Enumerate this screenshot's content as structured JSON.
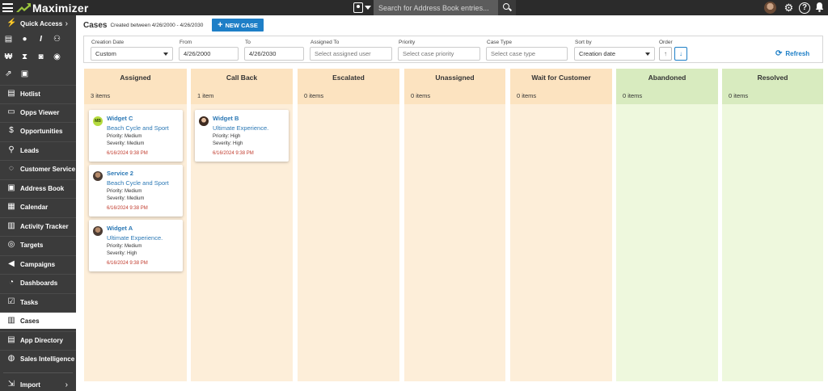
{
  "app": {
    "name": "Maximizer",
    "search_placeholder": "Search for Address Book entries..."
  },
  "sidebar": {
    "quick_access": "Quick Access",
    "items": [
      {
        "label": "Hotlist",
        "icon": "list-icon"
      },
      {
        "label": "Opps Viewer",
        "icon": "window-icon"
      },
      {
        "label": "Opportunities",
        "icon": "dollar-icon"
      },
      {
        "label": "Leads",
        "icon": "person-search-icon"
      },
      {
        "label": "Customer Service",
        "icon": "chat-icon"
      },
      {
        "label": "Address Book",
        "icon": "contact-card-icon"
      },
      {
        "label": "Calendar",
        "icon": "calendar-icon"
      },
      {
        "label": "Activity Tracker",
        "icon": "clipboard-icon"
      },
      {
        "label": "Targets",
        "icon": "target-icon"
      },
      {
        "label": "Campaigns",
        "icon": "megaphone-icon"
      },
      {
        "label": "Dashboards",
        "icon": "gauge-icon"
      },
      {
        "label": "Tasks",
        "icon": "tasks-icon"
      },
      {
        "label": "Cases",
        "icon": "cases-icon",
        "active": true
      },
      {
        "label": "App Directory",
        "icon": "app-directory-icon"
      },
      {
        "label": "Sales Intelligence",
        "icon": "globe-icon"
      }
    ],
    "import": "Import"
  },
  "page": {
    "title": "Cases",
    "subtitle": "Created between 4/26/2000 - 4/26/2030",
    "new_case": "NEW CASE"
  },
  "filters": {
    "creation_date": {
      "label": "Creation Date",
      "value": "Custom"
    },
    "from": {
      "label": "From",
      "value": "4/26/2000"
    },
    "to": {
      "label": "To",
      "value": "4/26/2030"
    },
    "assigned_to": {
      "label": "Assigned To",
      "placeholder": "Select assigned user"
    },
    "priority": {
      "label": "Priority",
      "placeholder": "Select case priority"
    },
    "case_type": {
      "label": "Case Type",
      "placeholder": "Select case type"
    },
    "sort_by": {
      "label": "Sort by",
      "value": "Creation date"
    },
    "order": {
      "label": "Order"
    },
    "refresh": "Refresh"
  },
  "columns": [
    {
      "title": "Assigned",
      "count": "3 items",
      "head_color": "#fce3c0",
      "body_color": "#fdeed9",
      "cards": [
        {
          "name": "Widget C",
          "company": "Beach Cycle and Sport",
          "priority": "Priority: Medium",
          "severity": "Severity: Medium",
          "date": "6/16/2024 9:38 PM",
          "avatar_initials": "MB"
        },
        {
          "name": "Service 2",
          "company": "Beach Cycle and Sport",
          "priority": "Priority: Medium",
          "severity": "Severity: Medium",
          "date": "6/16/2024 9:38 PM",
          "avatar_initials": ""
        },
        {
          "name": "Widget A",
          "company": "Ultimate Experience.",
          "priority": "Priority: Medium",
          "severity": "Severity: High",
          "date": "6/16/2024 9:38 PM",
          "avatar_initials": ""
        }
      ]
    },
    {
      "title": "Call Back",
      "count": "1 item",
      "head_color": "#fce3c0",
      "body_color": "#fdeed9",
      "cards": [
        {
          "name": "Widget B",
          "company": "Ultimate Experience.",
          "priority": "Priority: High",
          "severity": "Severity: High",
          "date": "6/16/2024 9:38 PM",
          "avatar_initials": ""
        }
      ]
    },
    {
      "title": "Escalated",
      "count": "0 items",
      "head_color": "#fce3c0",
      "body_color": "#fdeed9",
      "cards": []
    },
    {
      "title": "Unassigned",
      "count": "0 items",
      "head_color": "#fce3c0",
      "body_color": "#fdeed9",
      "cards": []
    },
    {
      "title": "Wait for Customer",
      "count": "0 items",
      "head_color": "#fce3c0",
      "body_color": "#fdeed9",
      "cards": []
    },
    {
      "title": "Abandoned",
      "count": "0 items",
      "head_color": "#d8ebbf",
      "body_color": "#eef8dd",
      "cards": []
    },
    {
      "title": "Resolved",
      "count": "0 items",
      "head_color": "#d8ebbf",
      "body_color": "#eef8dd",
      "cards": []
    }
  ]
}
